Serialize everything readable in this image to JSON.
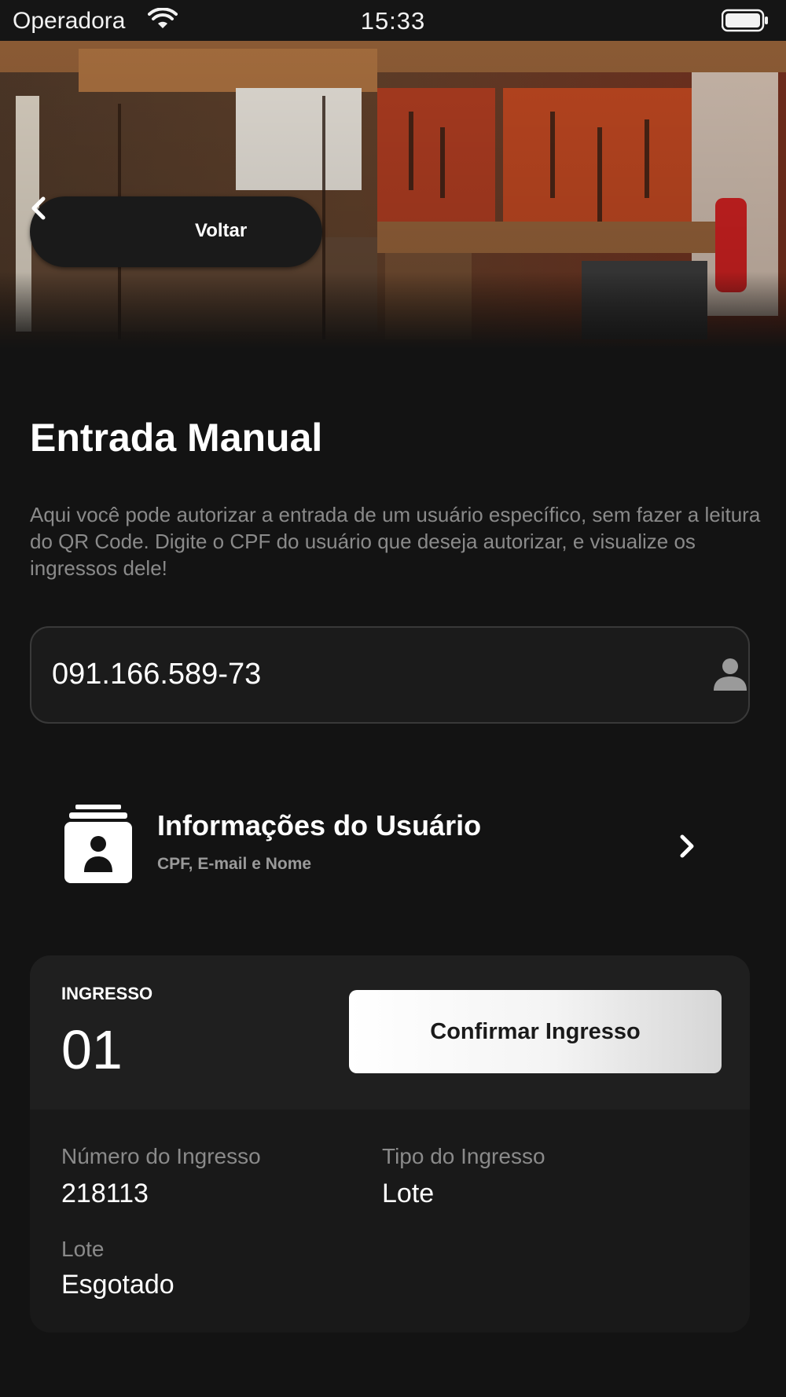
{
  "status_bar": {
    "carrier": "Operadora",
    "time": "15:33"
  },
  "header": {
    "back_label": "Voltar"
  },
  "page": {
    "title": "Entrada Manual",
    "description": "Aqui você pode autorizar a entrada de um usuário específico, sem fazer a leitura do QR Code. Digite o CPF do usuário que deseja autorizar, e visualize os ingressos dele!"
  },
  "cpf_input": {
    "value": "091.166.589-73",
    "icon": "user-icon"
  },
  "user_info": {
    "title": "Informações do Usuário",
    "subtitle": "CPF, E-mail e Nome"
  },
  "ticket": {
    "label": "INGRESSO",
    "number": "01",
    "confirm_label": "Confirmar Ingresso",
    "fields": [
      {
        "label": "Número do Ingresso",
        "value": "218113"
      },
      {
        "label": "Tipo do Ingresso",
        "value": "Lote"
      },
      {
        "label": "Lote",
        "value": "Esgotado"
      }
    ]
  },
  "colors": {
    "background": "#131313",
    "card": "#191919",
    "muted_text": "#8a8a8a",
    "button": "#ffffff"
  }
}
